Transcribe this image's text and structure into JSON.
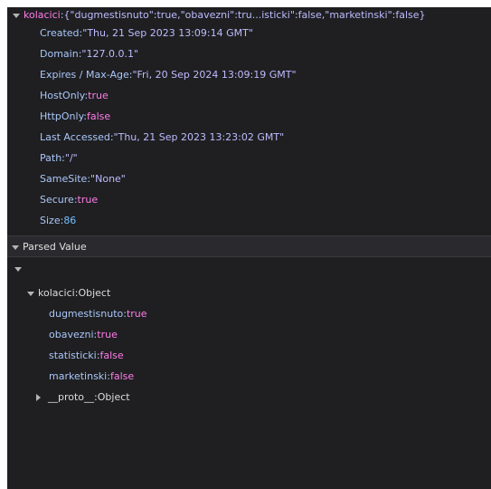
{
  "cookie": {
    "name": "kolacici",
    "value": "{\"dugmestisnuto\":true,\"obavezni\":tru...isticki\":false,\"marketinski\":false}",
    "properties": [
      {
        "key": "Created",
        "value": "\"Thu, 21 Sep 2023 13:09:14 GMT\"",
        "type": "string"
      },
      {
        "key": "Domain",
        "value": "\"127.0.0.1\"",
        "type": "string"
      },
      {
        "key": "Expires / Max-Age",
        "value": "\"Fri, 20 Sep 2024 13:09:19 GMT\"",
        "type": "string"
      },
      {
        "key": "HostOnly",
        "value": "true",
        "type": "bool"
      },
      {
        "key": "HttpOnly",
        "value": "false",
        "type": "bool"
      },
      {
        "key": "Last Accessed",
        "value": "\"Thu, 21 Sep 2023 13:23:02 GMT\"",
        "type": "string"
      },
      {
        "key": "Path",
        "value": "\"/\"",
        "type": "string"
      },
      {
        "key": "SameSite",
        "value": "\"None\"",
        "type": "string"
      },
      {
        "key": "Secure",
        "value": "true",
        "type": "bool"
      },
      {
        "key": "Size",
        "value": "86",
        "type": "num"
      }
    ]
  },
  "parsed_section": {
    "title": "Parsed Value",
    "object_key": "kolacici",
    "object_type": "Object",
    "fields": [
      {
        "key": "dugmestisnuto",
        "value": "true"
      },
      {
        "key": "obavezni",
        "value": "true"
      },
      {
        "key": "statisticki",
        "value": "false"
      },
      {
        "key": "marketinski",
        "value": "false"
      }
    ],
    "proto_key": "__proto__",
    "proto_value": "Object"
  },
  "colors": {
    "panel_bg": "#1f1f21",
    "key": "#aac7fa",
    "highlight_key": "#ff7de9",
    "string_value": "#bebbff",
    "bool_value": "#ff7de9",
    "number_value": "#75bfff"
  }
}
